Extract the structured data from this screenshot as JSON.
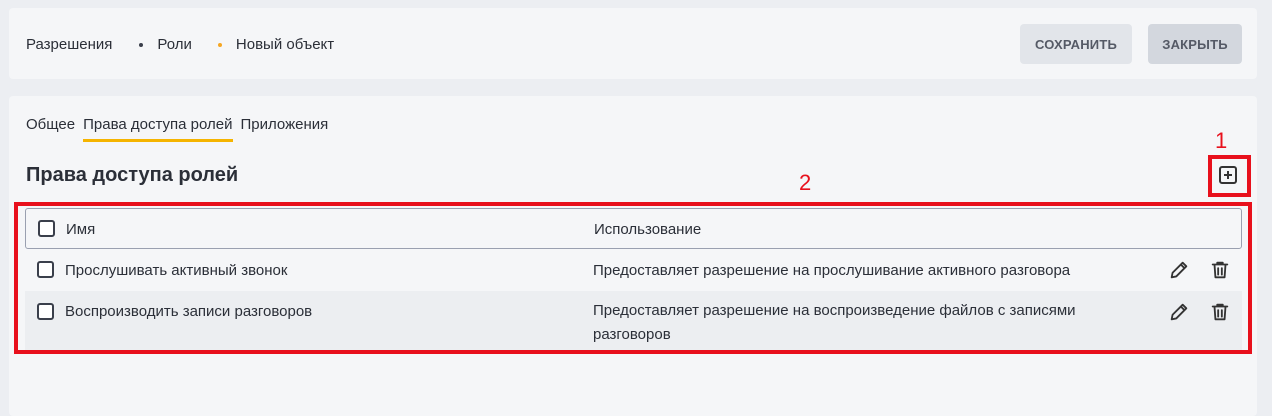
{
  "breadcrumb": {
    "items": [
      "Разрешения",
      "Роли",
      "Новый объект"
    ]
  },
  "toolbar": {
    "save_label": "СОХРАНИТЬ",
    "close_label": "ЗАКРЫТЬ"
  },
  "tabs": [
    {
      "label": "Общее",
      "active": false
    },
    {
      "label": "Права доступа ролей",
      "active": true
    },
    {
      "label": "Приложения",
      "active": false
    }
  ],
  "section": {
    "title": "Права доступа ролей"
  },
  "annotations": {
    "marker_1": "1",
    "marker_2": "2"
  },
  "table": {
    "columns": [
      "Имя",
      "Использование"
    ],
    "rows": [
      {
        "name": "Прослушивать активный звонок",
        "usage": "Предоставляет разрешение на прослушивание активного разговора"
      },
      {
        "name": "Воспроизводить записи разговоров",
        "usage": "Предоставляет разрешение на воспроизведение файлов с записями разговоров"
      }
    ]
  },
  "colors": {
    "accent": "#f5b400",
    "annotation_red": "#e8101c",
    "separator_orange": "#f5a623"
  },
  "icons": [
    "plus-square-icon",
    "pencil-icon",
    "trash-icon"
  ]
}
